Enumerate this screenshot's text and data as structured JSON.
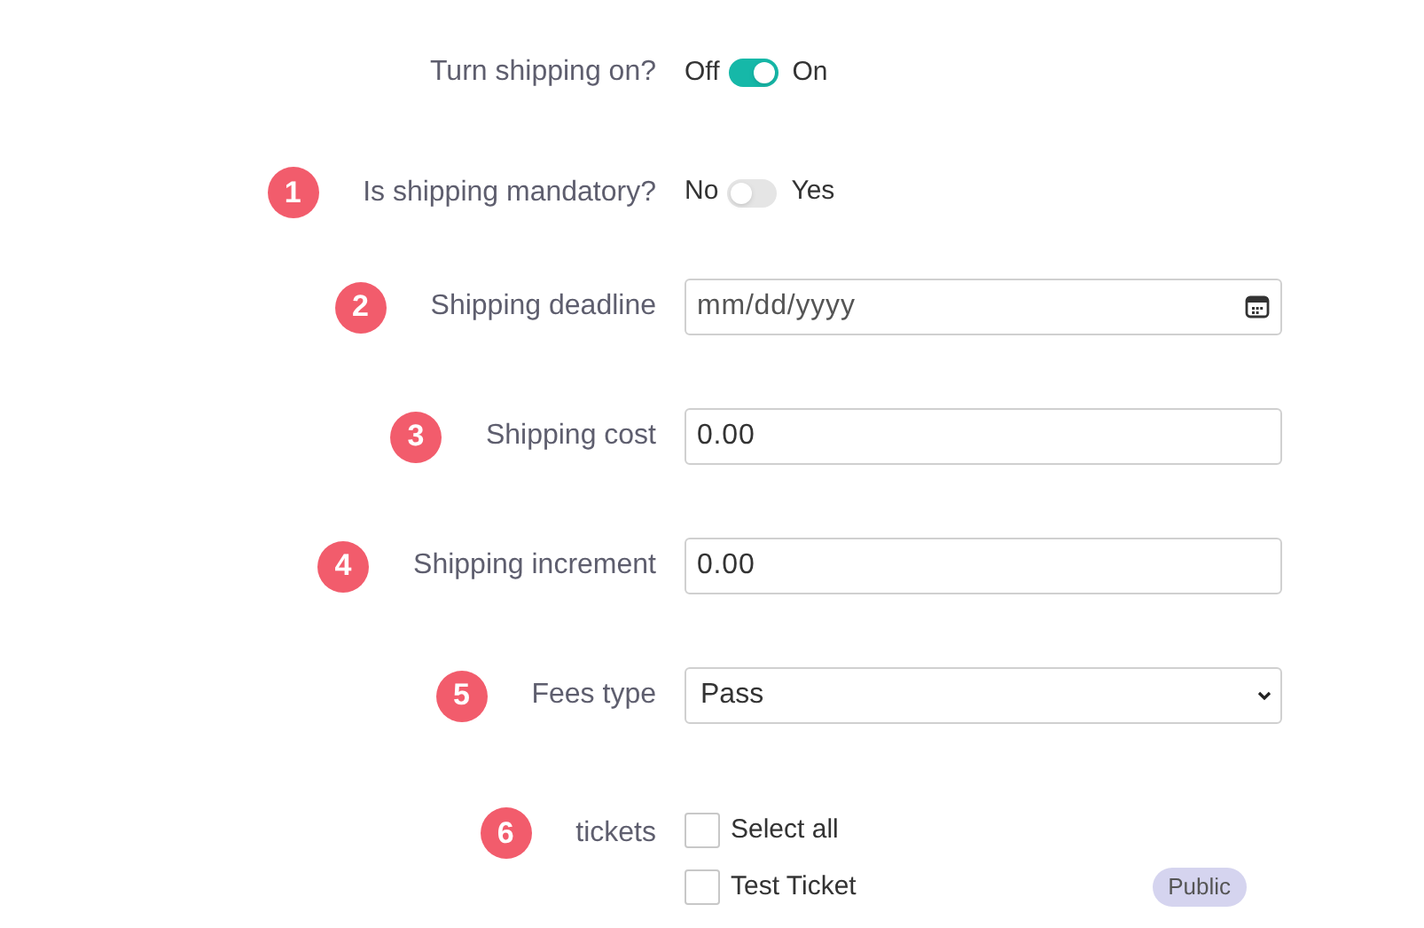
{
  "fields": [
    {
      "kind": "toggle",
      "label": "Turn shipping on?",
      "off_label": "Off",
      "on_label": "On",
      "on": true
    },
    {
      "kind": "toggle",
      "number": "1",
      "label": "Is shipping mandatory?",
      "off_label": "No",
      "on_label": "Yes",
      "on": false
    },
    {
      "kind": "date",
      "number": "2",
      "label": "Shipping deadline",
      "placeholder": "mm/dd/yyyy"
    },
    {
      "kind": "text",
      "number": "3",
      "label": "Shipping cost",
      "value": "0.00"
    },
    {
      "kind": "text",
      "number": "4",
      "label": "Shipping increment",
      "value": "0.00"
    },
    {
      "kind": "select",
      "number": "5",
      "label": "Fees type",
      "value": "Pass"
    },
    {
      "kind": "checklist",
      "number": "6",
      "label": "tickets",
      "items": [
        {
          "label": "Select all",
          "checked": false
        },
        {
          "label": "Test Ticket",
          "checked": false,
          "tag": "Public"
        }
      ]
    }
  ]
}
